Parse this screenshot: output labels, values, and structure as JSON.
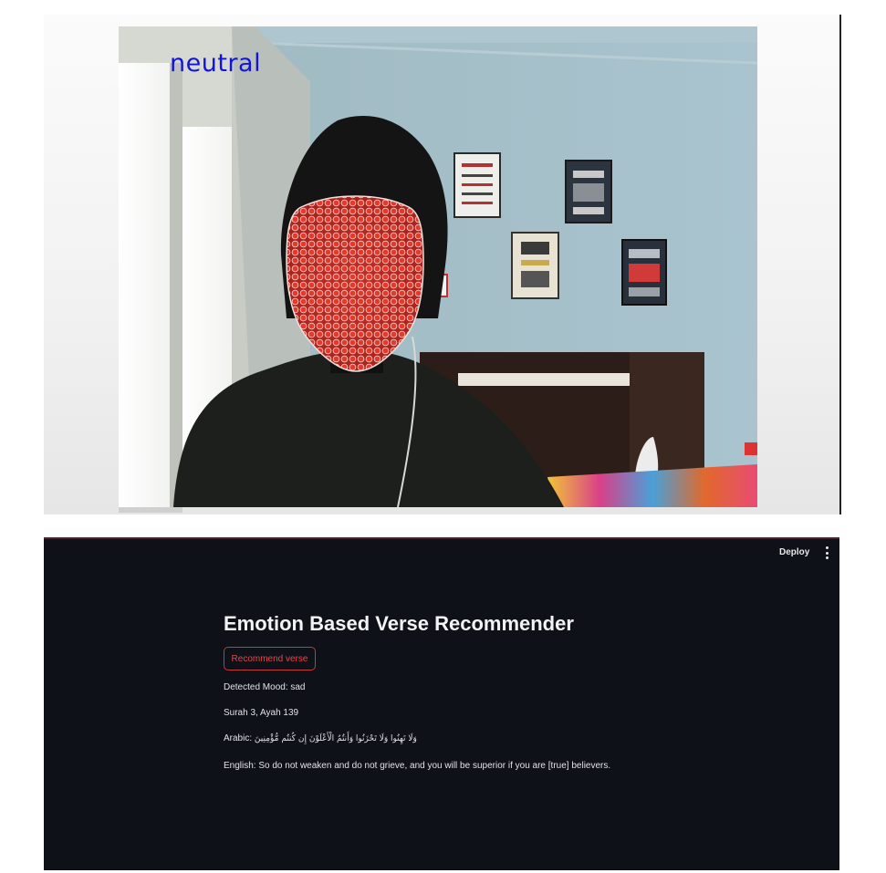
{
  "webcam": {
    "emotion_overlay": "neutral",
    "overlay_color": "#1414d8",
    "landmark_color": "#e23b2e"
  },
  "app": {
    "deploy_label": "Deploy",
    "menu_icon": "vertical-ellipsis-icon",
    "title": "Emotion Based Verse Recommender",
    "recommend_button_label": "Recommend verse",
    "accent_color": "#e2474d",
    "background_color": "#0e1117",
    "mood_line": "Detected Mood: sad",
    "surah_line": "Surah 3, Ayah 139",
    "arabic_label": "Arabic:",
    "arabic_text": "وَلَا تَهِنُوا وَلَا تَحْزَنُوا وَأَنتُمُ الْأَعْلَوْنَ إِن كُنتُم مُّؤْمِنِينَ",
    "english_line": "English: So do not weaken and do not grieve, and you will be superior if you are [true] believers."
  }
}
